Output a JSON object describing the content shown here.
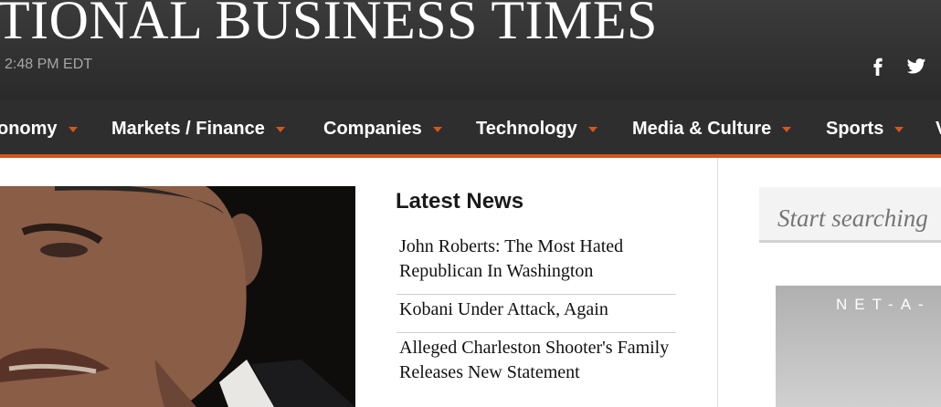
{
  "header": {
    "masthead": "TIONAL BUSINESS TIMES",
    "timestamp": "2:48 PM EDT",
    "social": [
      {
        "icon": "facebook-icon"
      },
      {
        "icon": "twitter-icon"
      }
    ]
  },
  "nav": {
    "items": [
      {
        "label": "onomy"
      },
      {
        "label": "Markets / Finance"
      },
      {
        "label": "Companies"
      },
      {
        "label": "Technology"
      },
      {
        "label": "Media & Culture"
      },
      {
        "label": "Sports"
      },
      {
        "label": "V"
      }
    ],
    "accent_color": "#d4551b"
  },
  "latest_news": {
    "title": "Latest News",
    "items": [
      "John Roberts: The Most Hated Republican In Washington",
      "Kobani Under Attack, Again",
      "Alleged Charleston Shooter's Family Releases New Statement"
    ]
  },
  "search": {
    "placeholder": "Start searching"
  },
  "ad": {
    "brand": "NET-A-"
  }
}
